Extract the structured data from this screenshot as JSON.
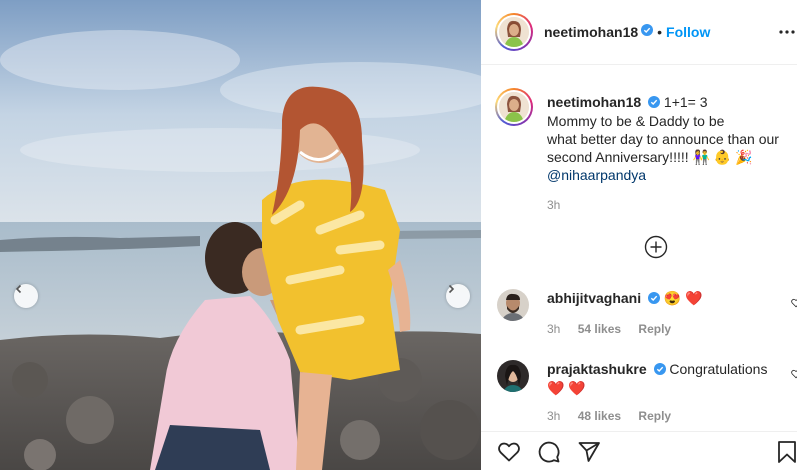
{
  "post": {
    "username": "neetimohan18",
    "follow_label": "Follow",
    "separator": "•"
  },
  "caption": {
    "username": "neetimohan18",
    "text_line1": "1+1= 3",
    "text_line2": "Mommy to be & Daddy to be",
    "text_line3": "what better day to announce than our",
    "text_line4": "second Anniversary!!!!! 👫 👶 🎉",
    "mention": "@nihaarpandya",
    "time": "3h"
  },
  "comments": [
    {
      "username": "abhijitvaghani",
      "text": "😍 ❤️",
      "time": "3h",
      "likes": "54 likes",
      "reply": "Reply"
    },
    {
      "username": "prajaktashukre",
      "text": "Congratulations",
      "text2": "❤️ ❤️",
      "time": "3h",
      "likes": "48 likes",
      "reply": "Reply"
    }
  ],
  "icons": {
    "verified": "verified-badge-icon",
    "more": "more-options-icon",
    "add": "add-comment-circle-icon",
    "like": "heart-icon",
    "comment": "comment-icon",
    "share": "share-icon",
    "save": "bookmark-icon"
  },
  "colors": {
    "accent": "#0095f6",
    "verified": "#3897f0",
    "heart": "#ed4956"
  }
}
